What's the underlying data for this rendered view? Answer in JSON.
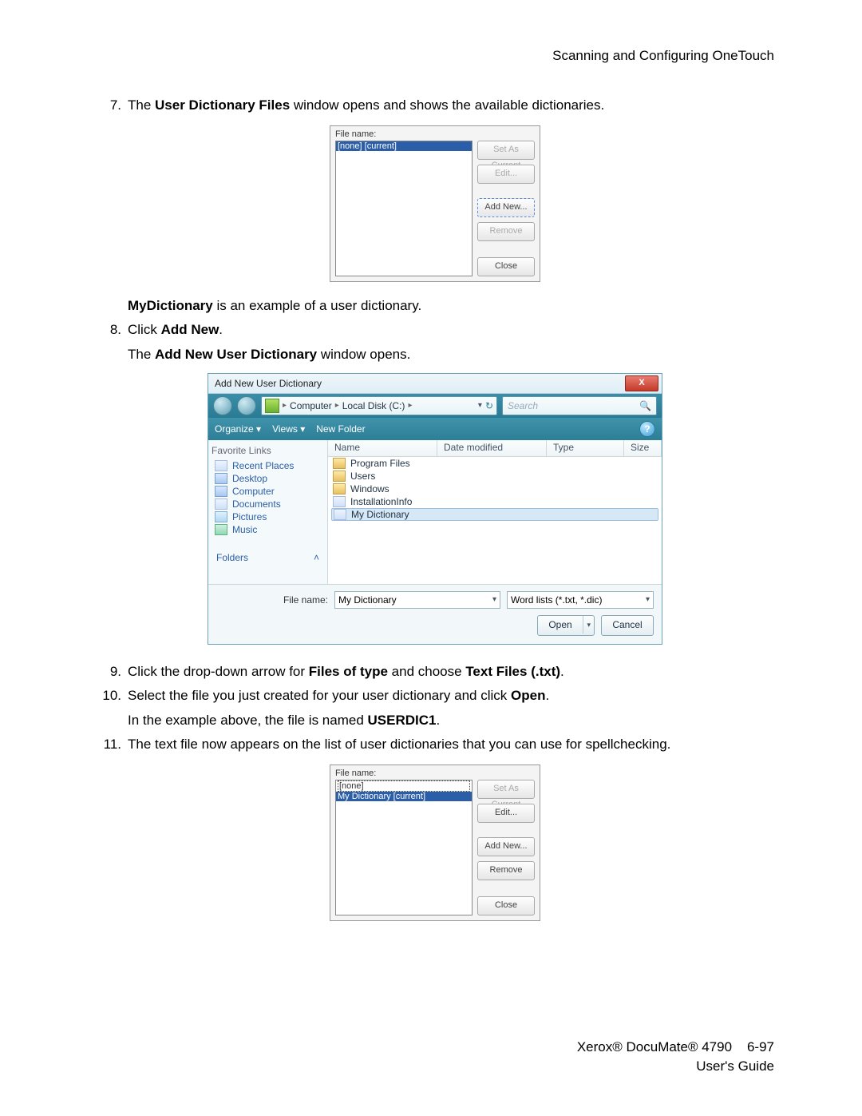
{
  "header": "Scanning and Configuring OneTouch",
  "steps": {
    "s7": {
      "num": "7.",
      "pre": "The ",
      "b1": "User Dictionary Files",
      "post": " window opens and shows the available dictionaries."
    },
    "mydict": {
      "b": "MyDictionary",
      "post": " is an example of a user dictionary."
    },
    "s8a": {
      "num": "8.",
      "pre": "Click ",
      "b": "Add New",
      "post": "."
    },
    "s8b": {
      "pre": "The ",
      "b": "Add New User Dictionary",
      "post": " window opens."
    },
    "s9": {
      "num": "9.",
      "pre": "Click the drop-down arrow for ",
      "b1": "Files of type",
      "mid": " and choose ",
      "b2": "Text Files (.txt)",
      "post": "."
    },
    "s10a": {
      "num": "10.",
      "pre": "Select the file you just created for your user dictionary and click ",
      "b": "Open",
      "post": "."
    },
    "s10b": {
      "pre": "In the example above, the file is named ",
      "b": "USERDIC1",
      "post": "."
    },
    "s11": {
      "num": "11.",
      "text": "The text file now appears on the list of user dictionaries that you can use for spellchecking."
    }
  },
  "dictDialog1": {
    "label": "File name:",
    "items": [
      "[none]  [current]"
    ],
    "selectedIndex": 0,
    "buttons": {
      "setCurrent": "Set As Current",
      "edit": "Edit...",
      "addNew": "Add New...",
      "remove": "Remove",
      "close": "Close"
    }
  },
  "dictDialog2": {
    "label": "File name:",
    "items": [
      "[none]",
      "My Dictionary  [current]"
    ],
    "selectedIndex": 1,
    "buttons": {
      "setCurrent": "Set As Current",
      "edit": "Edit...",
      "addNew": "Add New...",
      "remove": "Remove",
      "close": "Close"
    }
  },
  "fileDialog": {
    "title": "Add New User Dictionary",
    "crumb1": "Computer",
    "crumb2": "Local Disk (C:)",
    "searchPlaceholder": "Search",
    "toolbar": {
      "organize": "Organize ▾",
      "views": "Views ▾",
      "newFolder": "New Folder"
    },
    "fav": {
      "header": "Favorite Links",
      "items": [
        "Recent Places",
        "Desktop",
        "Computer",
        "Documents",
        "Pictures",
        "Music"
      ],
      "folders": "Folders"
    },
    "columns": {
      "name": "Name",
      "date": "Date modified",
      "type": "Type",
      "size": "Size"
    },
    "rows": [
      "Program Files",
      "Users",
      "Windows",
      "InstallationInfo",
      "My Dictionary"
    ],
    "selectedRow": 4,
    "fileNameLabel": "File name:",
    "fileNameValue": "My Dictionary",
    "fileType": "Word lists (*.txt, *.dic)",
    "open": "Open",
    "cancel": "Cancel"
  },
  "footer": {
    "line1a": "Xerox® DocuMate® 4790",
    "line1b": "6-97",
    "line2": "User's Guide"
  }
}
